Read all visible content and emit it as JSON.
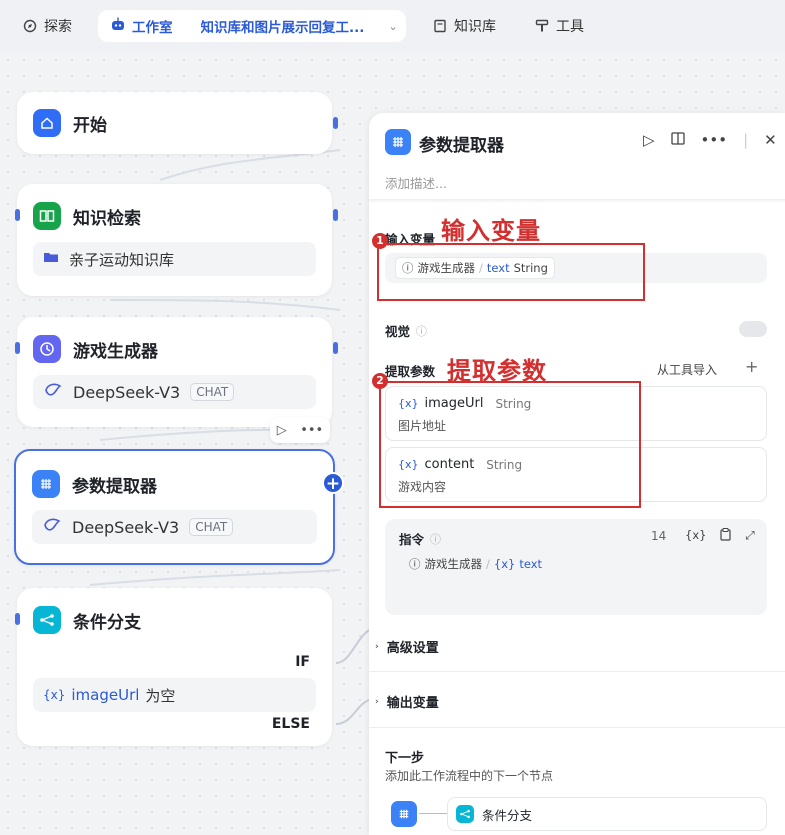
{
  "topbar": {
    "explore": "探索",
    "studio": "工作室",
    "project": "知识库和图片展示回复工...",
    "knowledge": "知识库",
    "tools": "工具"
  },
  "nodes": {
    "start": {
      "title": "开始"
    },
    "kb": {
      "title": "知识检索",
      "sub": "亲子运动知识库"
    },
    "game": {
      "title": "游戏生成器",
      "model": "DeepSeek-V3",
      "chip": "CHAT"
    },
    "extractor": {
      "title": "参数提取器",
      "model": "DeepSeek-V3",
      "chip": "CHAT"
    },
    "branch": {
      "title": "条件分支",
      "if": "IF",
      "else": "ELSE",
      "cond_var": "{x}",
      "cond_name": "imageUrl",
      "cond_op": "为空"
    }
  },
  "panel": {
    "title": "参数提取器",
    "description_placeholder": "添加描述...",
    "input_label": "输入变量",
    "input_source": "游戏生成器",
    "input_var": "text",
    "input_type": "String",
    "vision_label": "视觉",
    "extract_label": "提取参数",
    "import_label": "从工具导入",
    "params": [
      {
        "name": "imageUrl",
        "type": "String",
        "desc": "图片地址"
      },
      {
        "name": "content",
        "type": "String",
        "desc": "游戏内容"
      }
    ],
    "instruction_label": "指令",
    "instruction_count": "14",
    "instruction_source": "游戏生成器",
    "instruction_var": "text",
    "advanced_label": "高级设置",
    "output_label": "输出变量",
    "next_label": "下一步",
    "next_desc": "添加此工作流程中的下一个节点",
    "next_node": "条件分支"
  },
  "annotations": {
    "one": "1",
    "one_text": "输入变量",
    "two": "2",
    "two_text": "提取参数"
  },
  "colors": {
    "accent": "#2a5ad8",
    "annotation": "#d32f2f"
  }
}
